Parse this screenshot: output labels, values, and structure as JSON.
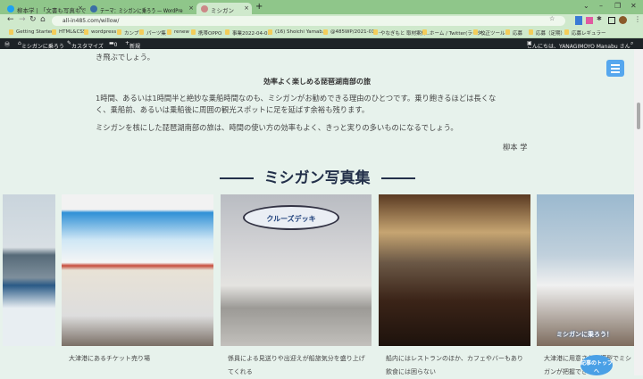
{
  "browser": {
    "tabs": [
      {
        "label": "柳本学 | 「文書も写真もできるんか」",
        "icon_color": "#1da1f2"
      },
      {
        "label": "テーマ：ミシガンに乗ろう — WordPre",
        "icon_color": "#3b6ea5"
      },
      {
        "label": "ミシガン",
        "icon_color": "#c88"
      }
    ],
    "url": "all-in485.com/willow/",
    "bookmarks": [
      "Getting Started",
      "HTML&CSS",
      "wordpress",
      "カンプ",
      "パーツ集",
      "renew",
      "携帯OPPO",
      "事業2022-04-01",
      "(16) Shoichi Yamab...",
      "@485WP/2021-01-...",
      "やなぎもと 取材案件...",
      "ホーム / Twitter(ライタ...",
      "校正ツール",
      "応募",
      "応募（定期）",
      "応募レギュラー"
    ]
  },
  "wpbar": {
    "site": "ミシガンに乗ろう",
    "customize": "カスタマイズ",
    "comments": "0",
    "new": "新規",
    "greeting": "こんにちは、YANAGIMOYO Manabu さん"
  },
  "article": {
    "line0": "き飛ぶでしょう。",
    "heading": "効率よく楽しめる琵琶湖南部の旅",
    "para1a": "1時間、あるいは1時間半と絶妙な乗船時間なのも、ミシガンがお勧めできる理由のひとつです。乗り飽きるほどは長くな",
    "para1b": "く、乗船前、あるいは乗船後に周囲の観光スポットに足を延ばす余裕も残ります。",
    "para2": "ミシガンを核にした琵琶湖南部の旅は、時間の使い方の効率もよく、きっと実りの多いものになるでしょう。",
    "author": "柳本 学"
  },
  "gallery": {
    "title": "ミシガン写真集",
    "captions": [
      "大津港にあるチケット売り場",
      "係員による見送りや出迎えが船旅気分を盛り上げてくれる",
      "船内にはレストランのほか、カフェやバーもあり飲食には困らない",
      "大津港に用意された模型でミシガンが把握できる"
    ],
    "photo3_sign": "クルーズデッキ",
    "photo5_label": "ミシガンに乗ろう！"
  },
  "totop": "記事のトップへ"
}
